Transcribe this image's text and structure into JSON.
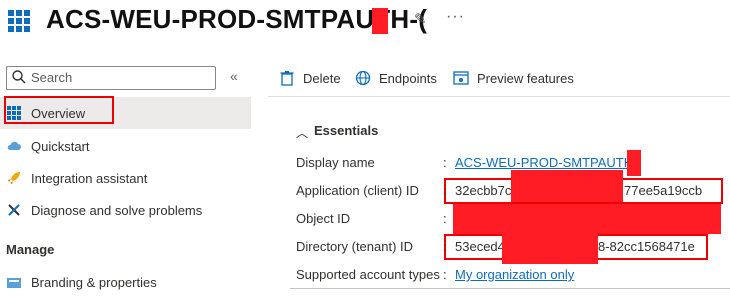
{
  "header": {
    "title": "ACS-WEU-PROD-SMTPAUTH-(",
    "pin_glyph": "✎",
    "more_glyph": "···"
  },
  "sidebar": {
    "search_placeholder": "Search",
    "collapse_glyph": "«",
    "items": [
      {
        "label": "Overview",
        "icon": "app-grid-icon"
      },
      {
        "label": "Quickstart",
        "icon": "cloud-icon"
      },
      {
        "label": "Integration assistant",
        "icon": "rocket-icon"
      },
      {
        "label": "Diagnose and solve problems",
        "icon": "wrench-icon"
      }
    ],
    "section_manage": "Manage",
    "manage_items": [
      {
        "label": "Branding & properties",
        "icon": "branding-icon"
      }
    ]
  },
  "toolbar": {
    "delete_label": "Delete",
    "endpoints_label": "Endpoints",
    "preview_label": "Preview features"
  },
  "essentials": {
    "title": "Essentials",
    "rows": [
      {
        "label": "Display name",
        "value": "ACS-WEU-PROD-SMTPAUTH-"
      },
      {
        "label": "Application (client) ID",
        "value_start": "32ecbb7c",
        "value_end": "77ee5a19ccb"
      },
      {
        "label": "Object ID",
        "value": ""
      },
      {
        "label": "Directory (tenant) ID",
        "value_start": "53eced4",
        "value_end": "8-82cc1568471e"
      },
      {
        "label": "Supported account types",
        "value": "My organization only"
      }
    ]
  },
  "colors": {
    "accent": "#0f6cbd",
    "redaction": "#ff1c24",
    "highlight_outline": "#e00000"
  }
}
